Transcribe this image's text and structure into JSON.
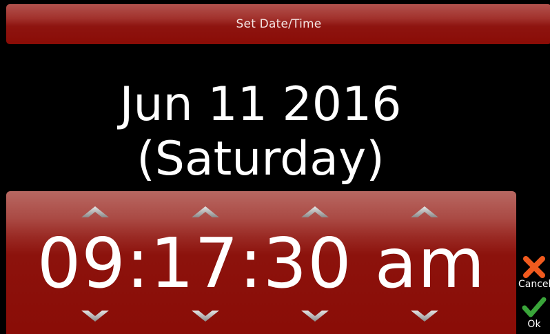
{
  "header": {
    "title": "Set Date/Time"
  },
  "date": {
    "line1": "Jun 11 2016",
    "line2": "(Saturday)"
  },
  "time": {
    "display": "09:17:30 am",
    "hour": "09",
    "minute": "17",
    "second": "30",
    "meridiem": "am"
  },
  "actions": {
    "cancel_label": "Cancel",
    "ok_label": "Ok",
    "cancel_icon": "close-x-icon",
    "ok_icon": "checkmark-icon"
  },
  "colors": {
    "panel_red": "#8a0c06",
    "cancel_orange": "#f05a1e",
    "ok_green": "#3aa53a"
  }
}
